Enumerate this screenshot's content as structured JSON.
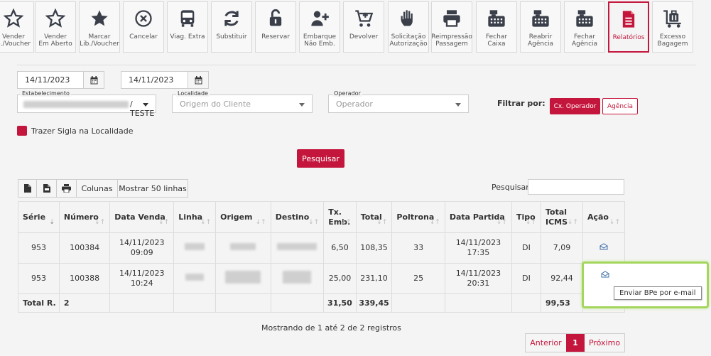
{
  "toolbar": {
    "buttons": [
      {
        "label": "Vender\nb./Voucher",
        "icon": "star-outline-icon"
      },
      {
        "label": "Vender\nEm Aberto",
        "icon": "star-outline-icon"
      },
      {
        "label": "Marcar\nLib./Voucher",
        "icon": "star-icon"
      },
      {
        "label": "Cancelar",
        "icon": "cancel-icon"
      },
      {
        "label": "Viag. Extra",
        "icon": "bus-icon"
      },
      {
        "label": "Substituir",
        "icon": "refresh-icon"
      },
      {
        "label": "Reservar",
        "icon": "unlock-icon"
      },
      {
        "label": "Embarque\nNão Emb.",
        "icon": "user-plus-icon"
      },
      {
        "label": "Devolver",
        "icon": "cart-return-icon"
      },
      {
        "label": "Solicitação\nAutorização",
        "icon": "hand-icon"
      },
      {
        "label": "Reimpressão\nPassagem",
        "icon": "printer-icon"
      },
      {
        "label": "Fechar\nCaixa",
        "icon": "cash-register-icon"
      },
      {
        "label": "Reabrir\nAgência",
        "icon": "cash-register-icon"
      },
      {
        "label": "Fechar\nAgência",
        "icon": "cash-register-icon"
      },
      {
        "label": "Relatórios",
        "icon": "report-icon",
        "active": true
      },
      {
        "label": "Excesso\nBagagem",
        "icon": "luggage-cart-icon"
      }
    ]
  },
  "filters": {
    "date_start": "14/11/2023",
    "date_end": "14/11/2023",
    "estabelecimento_label": "Estabelecimento",
    "estabelecimento_value": "/ TESTE",
    "localidade_label": "Localidade",
    "localidade_value": "Origem do Cliente",
    "operador_label": "Operador",
    "operador_value": "Operador",
    "filtrar_label": "Filtrar por:",
    "cx_operador": "Cx. Operador",
    "agencia": "Agência",
    "checkbox_label": "Trazer Sigla na Localidade",
    "search_button": "Pesquisar"
  },
  "table_controls": {
    "colunas": "Colunas",
    "mostrar": "Mostrar 50 linhas",
    "pesquisar_label": "Pesquisar"
  },
  "table": {
    "headers": [
      "Série",
      "Número",
      "Data Venda",
      "Linha",
      "Origem",
      "Destino",
      "Tx.\nEmb.",
      "Total",
      "Poltrona",
      "Data Partida",
      "Tipo",
      "Total\nICMS",
      "Ação"
    ],
    "rows": [
      {
        "serie": "953",
        "numero": "100384",
        "data_venda": "14/11/2023\n09:09",
        "tx_emb": "6,50",
        "total": "108,35",
        "poltrona": "33",
        "data_partida": "14/11/2023\n17:35",
        "tipo": "DI",
        "total_icms": "7,09"
      },
      {
        "serie": "953",
        "numero": "100388",
        "data_venda": "14/11/2023\n10:24",
        "tx_emb": "25,00",
        "total": "231,10",
        "poltrona": "25",
        "data_partida": "14/11/2023\n20:31",
        "tipo": "DI",
        "total_icms": "92,44"
      }
    ],
    "totals": {
      "label": "Total R.",
      "count": "2",
      "tx_emb": "31,50",
      "total": "339,45",
      "total_icms": "99,53"
    }
  },
  "tooltip": "Enviar BPe por e-mail",
  "pagination": {
    "info": "Mostrando de 1 até 2 de 2 registros",
    "prev": "Anterior",
    "current": "1",
    "next": "Próximo"
  },
  "colors": {
    "accent": "#c4163c",
    "highlight": "#a4d65e",
    "icon": "#3a3f4a"
  }
}
